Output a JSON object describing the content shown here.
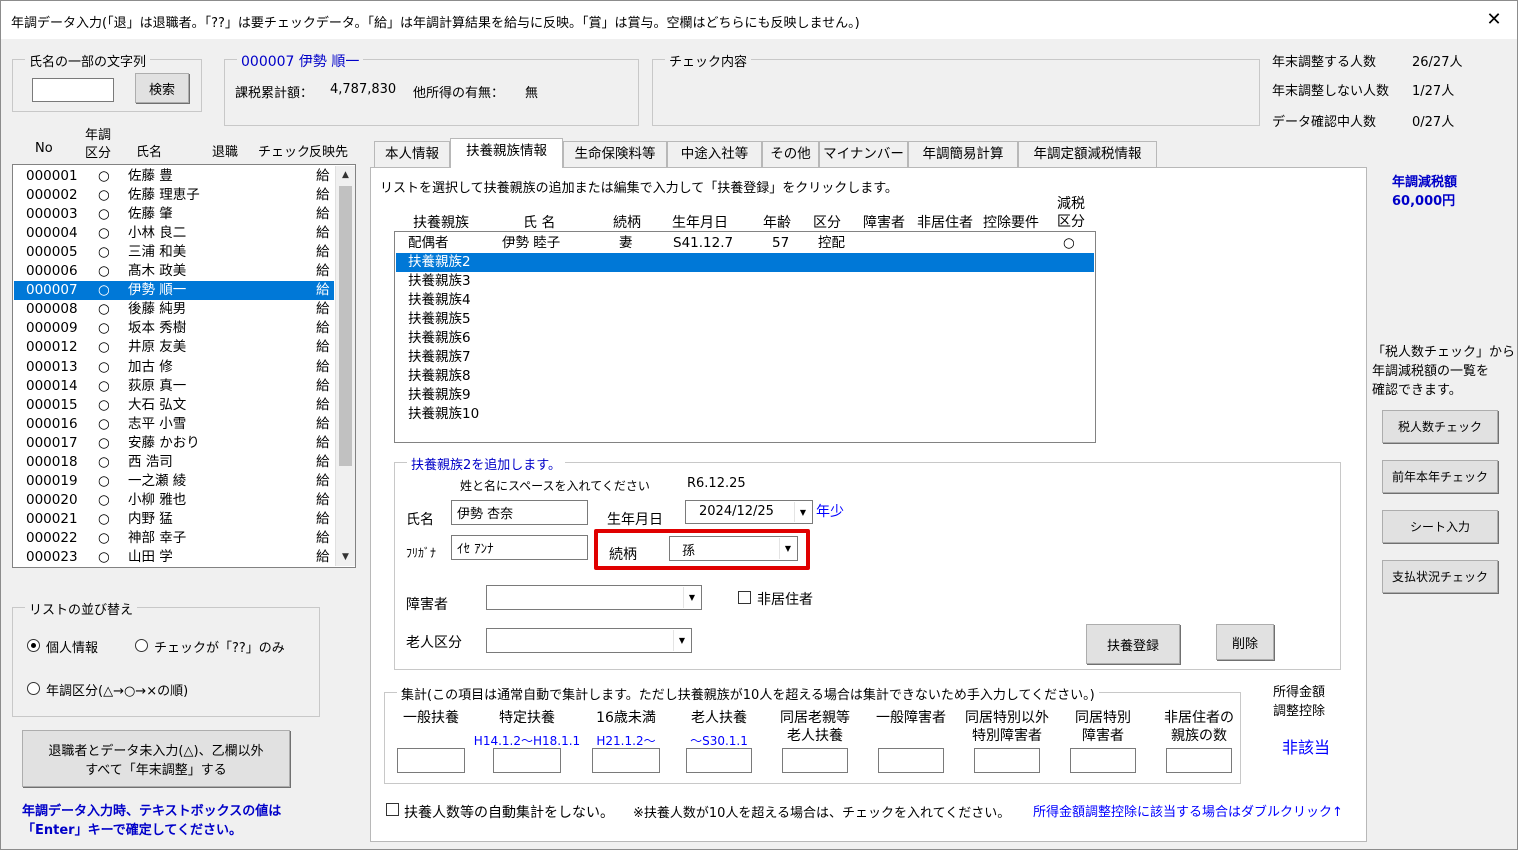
{
  "title": "年調データ入力(「退」は退職者。「??」は要チェックデータ。「給」は年調計算結果を給与に反映。「賞」は賞与。空欄はどちらにも反映しません。)",
  "close": "✕",
  "search": {
    "label": "氏名の一部の文字列",
    "value": "",
    "button": "検索"
  },
  "person": {
    "header": "000007  伊勢  順一",
    "taxable_label": "課税累計額：",
    "taxable_value": "4,787,830",
    "other_income_label": "他所得の有無：",
    "other_income_value": "無"
  },
  "check": {
    "label": "チェック内容"
  },
  "stats": [
    {
      "label": "年末調整する人数",
      "value": "26/27人"
    },
    {
      "label": "年末調整しない人数",
      "value": "1/27人"
    },
    {
      "label": "データ確認中人数",
      "value": "0/27人"
    }
  ],
  "list_headers": {
    "no": "No",
    "kubun1": "年調",
    "kubun2": "区分",
    "name": "氏名",
    "taishoku": "退職",
    "check": "チェック",
    "hanei": "反映先"
  },
  "employees": [
    {
      "no": "000001",
      "k": "○",
      "name": "佐藤 豊",
      "h": "給"
    },
    {
      "no": "000002",
      "k": "○",
      "name": "佐藤 理恵子",
      "h": "給"
    },
    {
      "no": "000003",
      "k": "○",
      "name": "佐藤 肇",
      "h": "給"
    },
    {
      "no": "000004",
      "k": "○",
      "name": "小林 良二",
      "h": "給"
    },
    {
      "no": "000005",
      "k": "○",
      "name": "三浦  和美",
      "h": "給"
    },
    {
      "no": "000006",
      "k": "○",
      "name": "髙木 政美",
      "h": "給"
    },
    {
      "no": "000007",
      "k": "○",
      "name": "伊勢  順一",
      "h": "給"
    },
    {
      "no": "000008",
      "k": "○",
      "name": "後藤 純男",
      "h": "給"
    },
    {
      "no": "000009",
      "k": "○",
      "name": "坂本 秀樹",
      "h": "給"
    },
    {
      "no": "000012",
      "k": "○",
      "name": "井原 友美",
      "h": "給"
    },
    {
      "no": "000013",
      "k": "○",
      "name": "加古 修",
      "h": "給"
    },
    {
      "no": "000014",
      "k": "○",
      "name": "荻原 真一",
      "h": "給"
    },
    {
      "no": "000015",
      "k": "○",
      "name": "大石 弘文",
      "h": "給"
    },
    {
      "no": "000016",
      "k": "○",
      "name": "志平 小雪",
      "h": "給"
    },
    {
      "no": "000017",
      "k": "○",
      "name": "安藤 かおり",
      "h": "給"
    },
    {
      "no": "000018",
      "k": "○",
      "name": "西 浩司",
      "h": "給"
    },
    {
      "no": "000019",
      "k": "○",
      "name": "一之瀬 綾",
      "h": "給"
    },
    {
      "no": "000020",
      "k": "○",
      "name": "小柳 雅也",
      "h": "給"
    },
    {
      "no": "000021",
      "k": "○",
      "name": "内野 猛",
      "h": "給"
    },
    {
      "no": "000022",
      "k": "○",
      "name": "神部 幸子",
      "h": "給"
    },
    {
      "no": "000023",
      "k": "○",
      "name": "山田 学",
      "h": "給"
    }
  ],
  "selected_employee": "000007",
  "sort": {
    "label": "リストの並び替え",
    "opt1": "個人情報",
    "opt2": "チェックが「??」のみ",
    "opt3": "年調区分(△→○→×の順)",
    "selected": "個人情報"
  },
  "bulk_button": {
    "line1": "退職者とデータ未入力(△)、乙欄以外",
    "line2": "すべて「年末調整」する"
  },
  "note": {
    "line1": "年調データ入力時、テキストボックスの値は",
    "line2": "「Enter」キーで確定してください。"
  },
  "tabs": [
    "本人情報",
    "扶養親族情報",
    "生命保険料等",
    "中途入社等",
    "その他",
    "マイナンバー",
    "年調簡易計算",
    "年調定額減税情報"
  ],
  "active_tab": "扶養親族情報",
  "instruction": "リストを選択して扶養親族の追加または編集で入力して「扶養登録」をクリックします。",
  "dep_headers": {
    "fuyo": "扶養親族",
    "name": "氏  名",
    "rel": "続柄",
    "dob": "生年月日",
    "age": "年齢",
    "kubun": "区分",
    "shogai": "障害者",
    "hikyo": "非居住者",
    "kojo": "控除要件",
    "gen1": "減税",
    "gen2": "区分"
  },
  "dependents": [
    {
      "fuyo": "配偶者",
      "name": "伊勢 睦子",
      "rel": "妻",
      "dob": "S41.12.7",
      "age": "57",
      "kubun": "控配",
      "gen": "○"
    },
    {
      "fuyo": "扶養親族2"
    },
    {
      "fuyo": "扶養親族3"
    },
    {
      "fuyo": "扶養親族4"
    },
    {
      "fuyo": "扶養親族5"
    },
    {
      "fuyo": "扶養親族6"
    },
    {
      "fuyo": "扶養親族7"
    },
    {
      "fuyo": "扶養親族8"
    },
    {
      "fuyo": "扶養親族9"
    },
    {
      "fuyo": "扶養親族10"
    }
  ],
  "selected_dependent": "扶養親族2",
  "add": {
    "legend": "扶養親族2を追加します。",
    "hint": "姓と名にスペースを入れてください",
    "date_ref": "R6.12.25",
    "name_label": "氏名",
    "name_value": "伊勢 杏奈",
    "kana_label": "ﾌﾘｶﾞﾅ",
    "kana_value": "ｲｾ ｱﾝﾅ",
    "dob_label": "生年月日",
    "dob_value": "2024/12/25",
    "nenshō": "年少",
    "rel_label": "続柄",
    "rel_value": "孫",
    "shogai_label": "障害者",
    "shogai_value": "",
    "hikyo_label": "非居住者",
    "rojin_label": "老人区分",
    "rojin_value": "",
    "register": "扶養登録",
    "delete": "削除"
  },
  "totals": {
    "legend": "集計(この項目は通常自動で集計します。ただし扶養親族が10人を超える場合は集計できないため手入力してください。)",
    "cols": [
      {
        "h1": "一般扶養",
        "h2": "",
        "sub": ""
      },
      {
        "h1": "特定扶養",
        "h2": "",
        "sub": "H14.1.2～H18.1.1"
      },
      {
        "h1": "16歳未満",
        "h2": "",
        "sub": "H21.1.2～"
      },
      {
        "h1": "老人扶養",
        "h2": "",
        "sub": "～S30.1.1"
      },
      {
        "h1": "同居老親等",
        "h2": "老人扶養",
        "sub": ""
      },
      {
        "h1": "一般障害者",
        "h2": "",
        "sub": ""
      },
      {
        "h1": "同居特別以外",
        "h2": "特別障害者",
        "sub": ""
      },
      {
        "h1": "同居特別",
        "h2": "障害者",
        "sub": ""
      },
      {
        "h1": "非居住者の",
        "h2": "親族の数",
        "sub": ""
      }
    ]
  },
  "shotoku": {
    "line1": "所得金額",
    "line2": "調整控除",
    "value": "非該当"
  },
  "auto_chk": "扶養人数等の自動集計をしない。",
  "auto_note": "※扶養人数が10人を超える場合は、チェックを入れてください。",
  "dblclick_note": "所得金額調整控除に該当する場合はダブルクリック↑",
  "genzei": {
    "label": "年調減税額",
    "value": "60,000円"
  },
  "side_note": {
    "l1": "「税人数チェック」から",
    "l2": "年調減税額の一覧を",
    "l3": "確認できます。"
  },
  "side_buttons": [
    "税人数チェック",
    "前年本年チェック",
    "シート入力",
    "支払状況チェック"
  ]
}
